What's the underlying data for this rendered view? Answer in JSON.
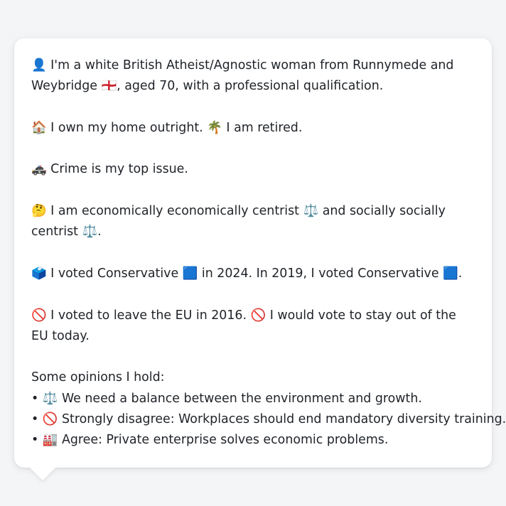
{
  "profile": {
    "intro": "👤 I'm a white British Atheist/Agnostic woman from Runnymede and Weybridge 🏴󠁧󠁢󠁥󠁮󠁧󠁿, aged 70, with a professional qualification.",
    "housing": "🏠 I own my home outright. 🌴 I am retired.",
    "issue": "🚓 Crime is my top issue.",
    "ideology": "🤔 I am economically economically centrist ⚖️ and socially socially centrist ⚖️.",
    "vote_history": "🗳️ I voted Conservative 🟦 in 2024. In 2019, I voted Conservative 🟦.",
    "eu": "🚫 I voted to leave the EU in 2016. 🚫 I would vote to stay out of the EU today."
  },
  "opinions": {
    "heading": "Some opinions I hold:",
    "items": [
      "• ⚖️ We need a balance between the environment and growth.",
      "• 🚫 Strongly disagree: Workplaces should end mandatory diversity training.",
      "• 🏭 Agree: Private enterprise solves economic problems."
    ]
  }
}
